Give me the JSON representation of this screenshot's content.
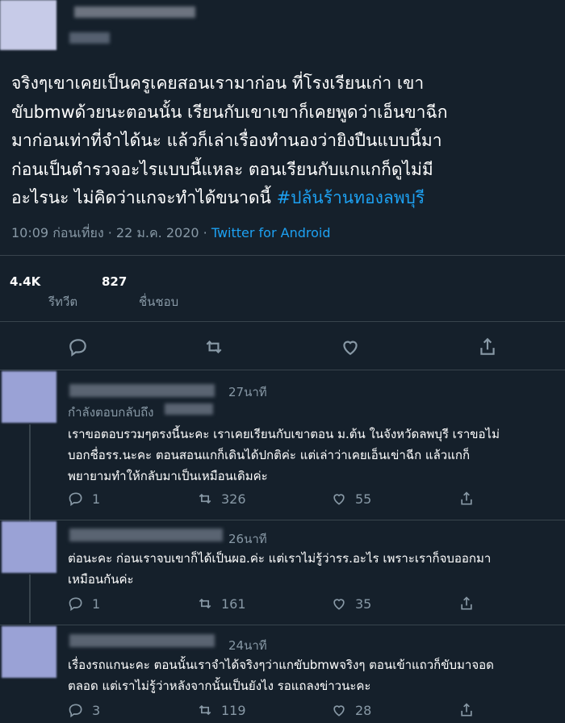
{
  "main_tweet": {
    "text_line1": "จริงๆเขาเคยเป็นครูเคยสอนเรามาก่อน ที่โรงเรียนเก่า เขา",
    "text_line2": "ขับbmwด้วยนะตอนนั้น  เรียนกับเขาเขาก็เคยพูดว่าเอ็นขาฉีก",
    "text_line3": "มาก่อนเท่าที่จำได้นะ แล้วก็เล่าเรื่องทำนองว่ายิงปืนแบบนี้มา",
    "text_line4": "ก่อนเป็นตำรวจอะไรแบบนี้แหละ ตอนเรียนกับแกแกก็ดูไม่มี",
    "text_line5": "อะไรนะ ไม่คิดว่าแกจะทำได้ขนาดนี้ ",
    "hashtag": "#ปล้นร้านทองลพบุรี",
    "time": "10:09 ก่อนเที่ยง · 22 ม.ค. 2020 · ",
    "app": "Twitter for Android",
    "retweets": "4.4K",
    "retweets_label": "รีทวีต",
    "likes": "827",
    "likes_label": "ชื่นชอบ"
  },
  "replies": [
    {
      "time": "27นาที",
      "replying_label": "กำลังตอบกลับถึง",
      "text": "เราขอตอบรวมๆตรงนี้นะคะ เราเคยเรียนกับเขาตอน ม.ต้น ในจังหวัดลพบุรี เราขอไม่\nบอกชื่อรร.นะคะ ตอนสอนแกก็เดินได้ปกติค่ะ แต่เล่าว่าเคยเอ็นเข่าฉีก แล้วแกก็\nพยายามทำให้กลับมาเป็นเหมือนเดิมค่ะ",
      "replies": "1",
      "retweets": "326",
      "likes": "55"
    },
    {
      "time": "26นาที",
      "text": "ต่อนะคะ ก่อนเราจบเขาก็ได้เป็นผอ.ค่ะ แต่เราไม่รู้ว่ารร.อะไร เพราะเราก็จบออกมา\nเหมือนกันค่ะ",
      "replies": "1",
      "retweets": "161",
      "likes": "35"
    },
    {
      "time": "24นาที",
      "text": "เรื่องรถแกนะคะ ตอนนั้นเราจำได้จริงๆว่าแกขับbmwจริงๆ ตอนเข้าแถวก็ขับมาจอด\nตลอด แต่เราไม่รู้ว่าหลังจากนั้นเป็นยังไง รอแถลงข่าวนะคะ",
      "replies": "3",
      "retweets": "119",
      "likes": "28"
    }
  ]
}
